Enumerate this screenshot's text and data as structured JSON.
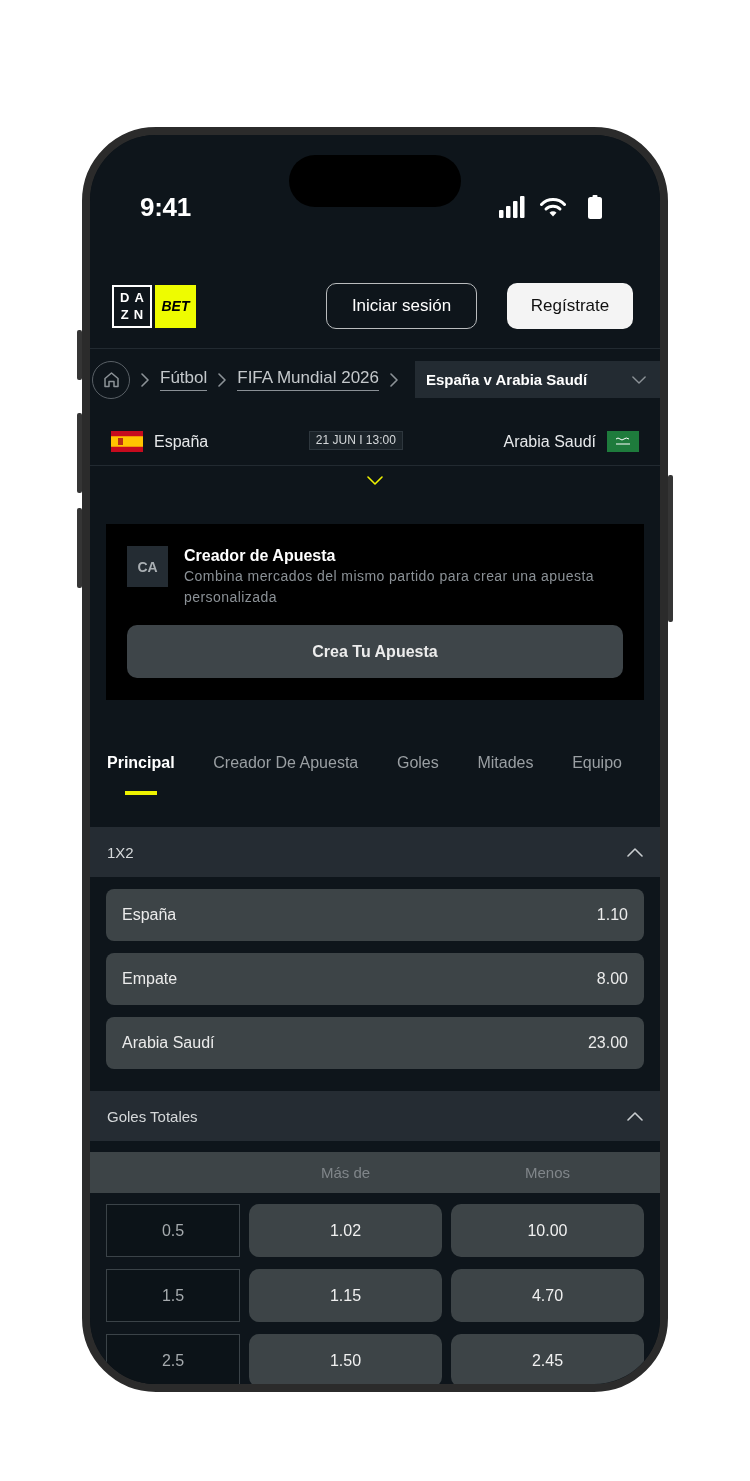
{
  "status_bar": {
    "time": "9:41"
  },
  "header": {
    "logo": {
      "wordmark_lines": [
        "DA",
        "ZN"
      ],
      "badge": "BET"
    },
    "buttons": [
      {
        "label": "Iniciar sesión",
        "kind": "outline"
      },
      {
        "label": "Regístrate",
        "kind": "filled"
      }
    ]
  },
  "breadcrumb": {
    "links": [
      "Fútbol",
      "FIFA Mundial 2026"
    ],
    "current": "España v Arabia Saudí"
  },
  "match": {
    "date": "21 JUN I 13:00",
    "home": "España",
    "away": "Arabia Saudí"
  },
  "bet_builder": {
    "badge": "CA",
    "title": "Creador de Apuesta",
    "description": "Combina mercados del mismo partido para crear una apuesta personalizada",
    "button": "Crea Tu Apuesta"
  },
  "tabs": [
    {
      "label": "Principal",
      "selected": true
    },
    {
      "label": "Creador De Apuesta",
      "selected": false
    },
    {
      "label": "Goles",
      "selected": false
    },
    {
      "label": "Mitades",
      "selected": false
    },
    {
      "label": "Equipo",
      "selected": false
    }
  ],
  "markets": [
    {
      "title": "1X2",
      "kind": "list",
      "expanded": true,
      "selections": [
        {
          "label": "España",
          "odds": "1.10"
        },
        {
          "label": "Empate",
          "odds": "8.00"
        },
        {
          "label": "Arabia Saudí",
          "odds": "23.00"
        }
      ]
    },
    {
      "title": "Goles Totales",
      "kind": "over_under",
      "expanded": true,
      "columns": [
        "Más de",
        "Menos"
      ],
      "rows": [
        {
          "line": "0.5",
          "odds": [
            "1.02",
            "10.00"
          ]
        },
        {
          "line": "1.5",
          "odds": [
            "1.15",
            "4.70"
          ]
        },
        {
          "line": "2.5",
          "odds": [
            "1.50",
            "2.45"
          ]
        }
      ]
    }
  ]
}
